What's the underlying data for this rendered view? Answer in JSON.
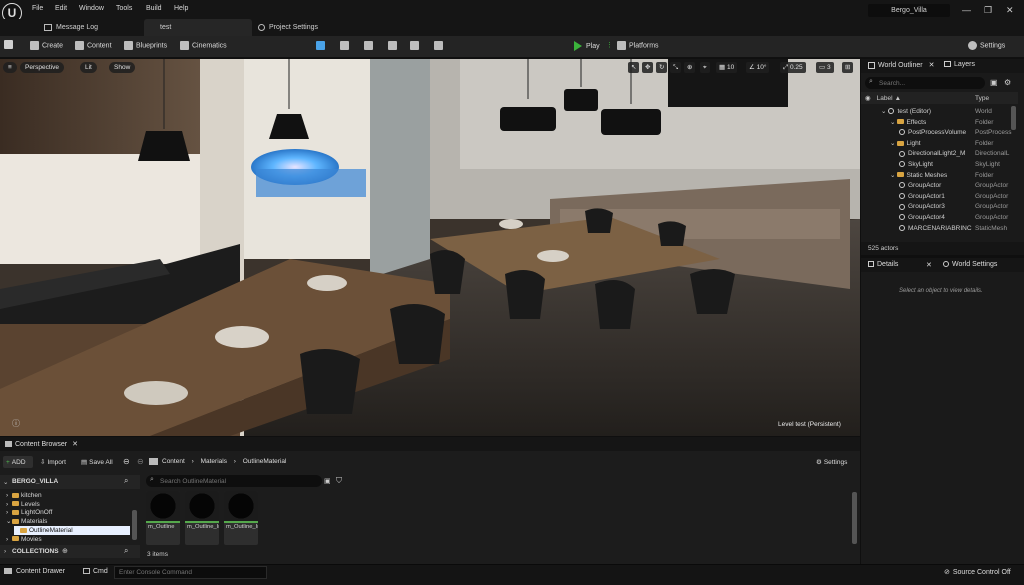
{
  "app": {
    "logo_text": "U",
    "menu": [
      "File",
      "Edit",
      "Window",
      "Tools",
      "Build",
      "Help"
    ],
    "project_name": "Bergo_Villa",
    "window_buttons": [
      "—",
      "❐",
      "✕"
    ]
  },
  "tabs": [
    {
      "label": "Message Log"
    },
    {
      "label": "test"
    },
    {
      "label": "Project Settings"
    }
  ],
  "toolbar": {
    "create": "Create",
    "content": "Content",
    "blueprints": "Blueprints",
    "cinematics": "Cinematics",
    "play": "Play",
    "platforms": "Platforms",
    "settings": "Settings"
  },
  "viewport": {
    "perspective": "Perspective",
    "lit": "Lit",
    "show": "Show",
    "grid_value": "10",
    "rotation_value": "10°",
    "scale_value": "0.25",
    "camera_speed": "3",
    "level_label": "Level  test (Persistent)"
  },
  "outliner": {
    "tab_label": "World Outliner",
    "layers_label": "Layers",
    "search_placeholder": "Search...",
    "col_label": "Label",
    "col_type": "Type",
    "rows": [
      {
        "label": "test (Editor)",
        "type": "World",
        "indent": 0,
        "kind": "world"
      },
      {
        "label": "Effects",
        "type": "Folder",
        "indent": 1,
        "kind": "folder"
      },
      {
        "label": "PostProcessVolume",
        "type": "PostProcess",
        "indent": 2,
        "kind": "actor"
      },
      {
        "label": "Light",
        "type": "Folder",
        "indent": 1,
        "kind": "folder"
      },
      {
        "label": "DirectionalLight2_M",
        "type": "DirectionalL",
        "indent": 2,
        "kind": "actor"
      },
      {
        "label": "SkyLight",
        "type": "SkyLight",
        "indent": 2,
        "kind": "actor"
      },
      {
        "label": "Static Meshes",
        "type": "Folder",
        "indent": 1,
        "kind": "folder"
      },
      {
        "label": "GroupActor",
        "type": "GroupActor",
        "indent": 2,
        "kind": "actor"
      },
      {
        "label": "GroupActor1",
        "type": "GroupActor",
        "indent": 2,
        "kind": "actor"
      },
      {
        "label": "GroupActor3",
        "type": "GroupActor",
        "indent": 2,
        "kind": "actor"
      },
      {
        "label": "GroupActor4",
        "type": "GroupActor",
        "indent": 2,
        "kind": "actor"
      },
      {
        "label": "MARCENARIABRINC",
        "type": "StaticMesh",
        "indent": 2,
        "kind": "actor"
      }
    ],
    "actor_count": "525 actors"
  },
  "details": {
    "tab_label": "Details",
    "world_settings_label": "World Settings",
    "empty_text": "Select an object to view details."
  },
  "content_browser": {
    "tab_label": "Content Browser",
    "add_label": "ADD",
    "import_label": "Import",
    "save_all_label": "Save All",
    "breadcrumb": [
      "Content",
      "Materials",
      "OutlineMaterial"
    ],
    "settings_label": "Settings",
    "project_root": "BERGO_VILLA",
    "folders": [
      {
        "label": "kitchen",
        "indent": 1
      },
      {
        "label": "Levels",
        "indent": 1
      },
      {
        "label": "LightOnOff",
        "indent": 1
      },
      {
        "label": "Materials",
        "indent": 1
      },
      {
        "label": "OutlineMaterial",
        "indent": 2
      },
      {
        "label": "Movies",
        "indent": 1
      }
    ],
    "collections_label": "COLLECTIONS",
    "search_placeholder": "Search OutlineMaterial",
    "assets": [
      {
        "label": "m_Outline"
      },
      {
        "label": "m_Outline_Inst"
      },
      {
        "label": "m_Outline_Inst1"
      }
    ],
    "item_count": "3 items"
  },
  "statusbar": {
    "content_drawer": "Content Drawer",
    "cmd": "Cmd",
    "console_placeholder": "Enter Console Command",
    "source_control": "Source Control Off"
  },
  "colors": {
    "accent_play": "#3bb33b",
    "folder": "#d9a441",
    "selection": "#2d6cb0",
    "panel_bg": "#1a1a1a"
  }
}
